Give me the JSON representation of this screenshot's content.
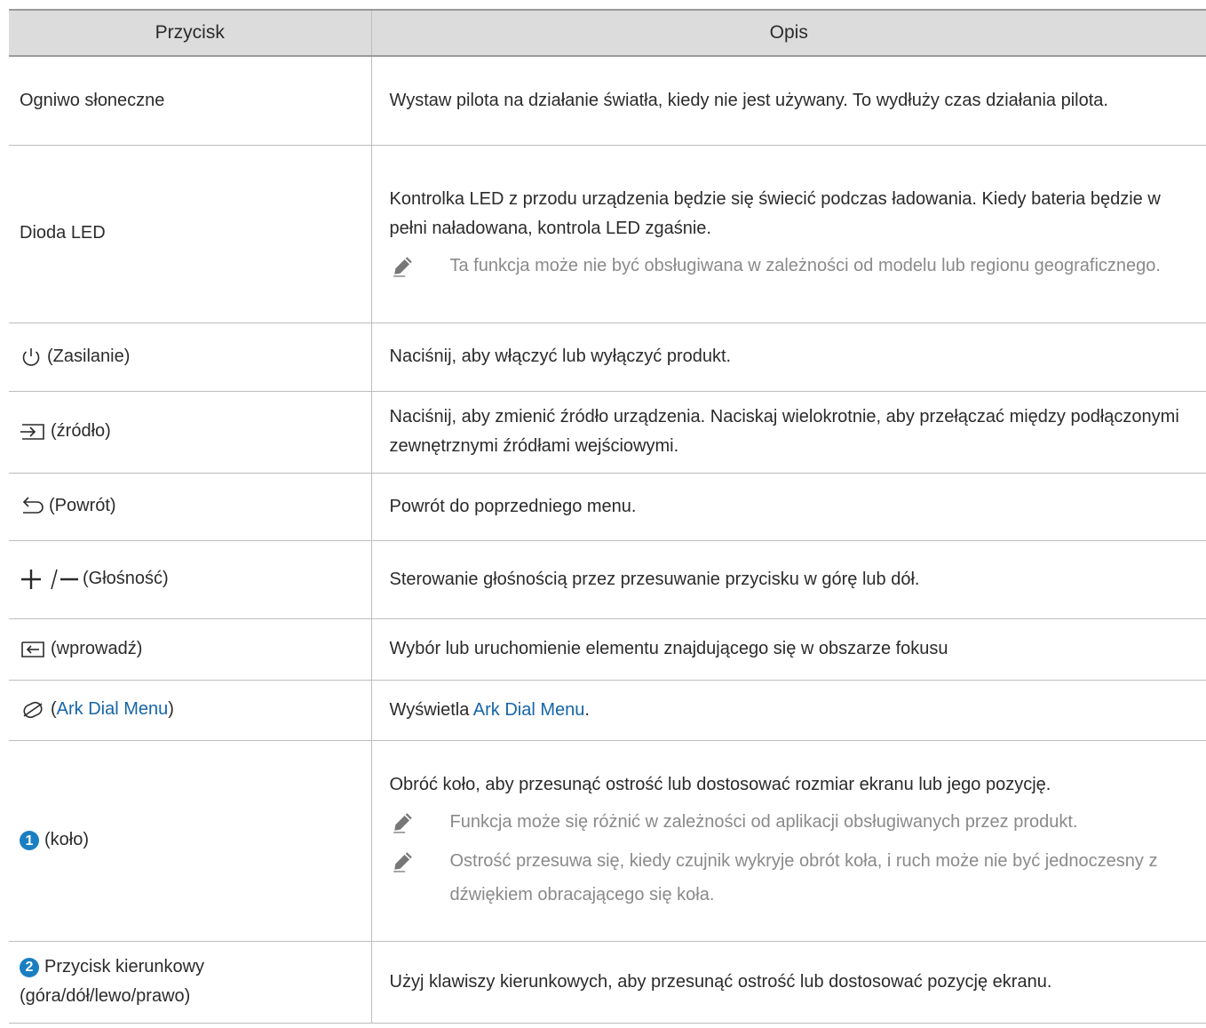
{
  "header": {
    "col1": "Przycisk",
    "col2": "Opis"
  },
  "rows": [
    {
      "button": "Ogniwo słoneczne",
      "desc": "Wystaw pilota na działanie światła, kiedy nie jest używany. To wydłuży czas działania pilota."
    },
    {
      "button": "Dioda LED",
      "desc": "Kontrolka LED z przodu urządzenia będzie się świecić podczas ładowania. Kiedy bateria będzie w pełni naładowana, kontrola LED zgaśnie.",
      "note": "Ta funkcja może nie być obsługiwana w zależności od modelu lub regionu geograficznego."
    },
    {
      "icon": "power-icon",
      "button": "(Zasilanie)",
      "desc": "Naciśnij, aby włączyć lub wyłączyć produkt."
    },
    {
      "icon": "source-icon",
      "button": "(źródło)",
      "desc": "Naciśnij, aby zmienić źródło urządzenia. Naciskaj wielokrotnie, aby przełączać między podłączonymi zewnętrznymi źródłami wejściowymi."
    },
    {
      "icon": "return-icon",
      "button": "(Powrót)",
      "desc": "Powrót do poprzedniego menu."
    },
    {
      "icon": "volume-icon",
      "button": "(Głośność)",
      "desc": "Sterowanie głośnością przez przesuwanie przycisku w górę lub dół."
    },
    {
      "icon": "enter-icon",
      "button": "(wprowadź)",
      "desc": "Wybór lub uruchomienie elementu znajdującego się w obszarze fokusu"
    },
    {
      "icon": "ark-dial-icon",
      "button_prefix": "(",
      "button_link": "Ark Dial Menu",
      "button_suffix": ")",
      "desc_prefix": "Wyświetla ",
      "desc_link": "Ark Dial Menu",
      "desc_suffix": "."
    },
    {
      "number": "1",
      "button": "(koło)",
      "desc": "Obróć koło, aby przesunąć ostrość lub dostosować rozmiar ekranu lub jego pozycję.",
      "notes": [
        "Funkcja może się różnić w zależności od aplikacji obsługiwanych przez produkt.",
        "Ostrość przesuwa się, kiedy czujnik wykryje obrót koła, i ruch może nie być jednoczesny z dźwiękiem obracającego się koła."
      ]
    },
    {
      "number": "2",
      "button": "Przycisk kierunkowy (góra/dół/lewo/prawo)",
      "desc": "Użyj klawiszy kierunkowych, aby przesunąć ostrość lub dostosować pozycję ekranu."
    }
  ],
  "colors": {
    "link": "#1565a8",
    "header_bg": "#dcdcdc",
    "number_badge": "#1a7fc1",
    "note_text": "#8a8a8a"
  }
}
